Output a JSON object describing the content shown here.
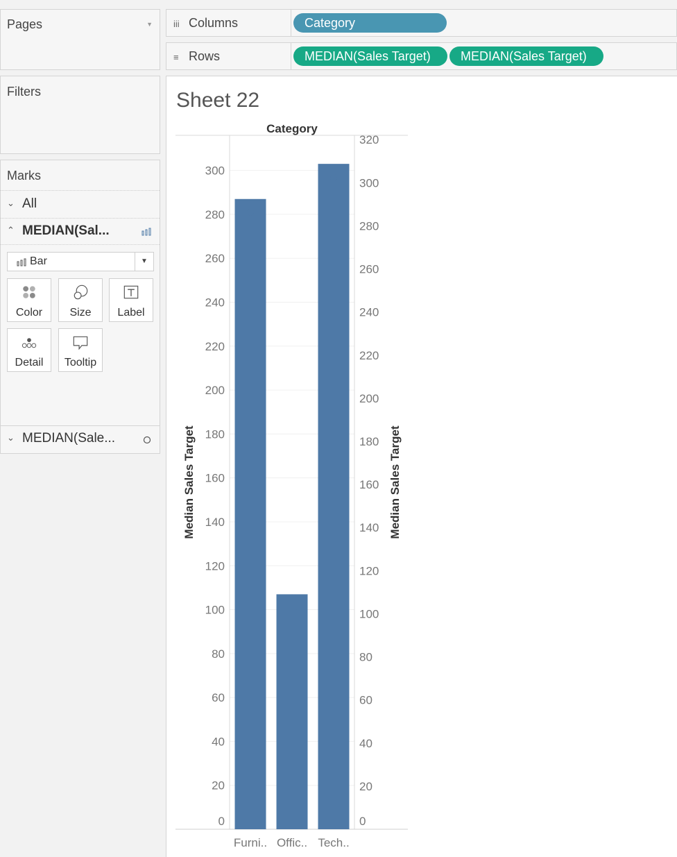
{
  "left_pane": {
    "pages": {
      "title": "Pages"
    },
    "filters": {
      "title": "Filters"
    },
    "marks": {
      "title": "Marks",
      "all_label": "All",
      "card1_label": "MEDIAN(Sal...",
      "mark_type": "Bar",
      "buttons": {
        "color": "Color",
        "size": "Size",
        "label": "Label",
        "detail": "Detail",
        "tooltip": "Tooltip"
      },
      "card2_label": "MEDIAN(Sale..."
    }
  },
  "shelves": {
    "columns": {
      "label": "Columns",
      "pills": [
        "Category"
      ]
    },
    "rows": {
      "label": "Rows",
      "pills": [
        "MEDIAN(Sales Target)",
        "MEDIAN(Sales Target)"
      ]
    }
  },
  "sheet": {
    "title": "Sheet 22"
  },
  "colors": {
    "bar": "#4e79a7",
    "dimension_pill": "#4996b2",
    "measure_pill": "#17a986"
  },
  "chart_data": {
    "type": "bar",
    "header": "Category",
    "categories": [
      "Furni..",
      "Offic..",
      "Tech.."
    ],
    "series": [
      {
        "values": [
          287,
          107,
          303
        ],
        "mark": "bar"
      },
      {
        "values": [
          287,
          107,
          303
        ],
        "mark": "circle"
      }
    ],
    "left_axis": {
      "label": "Median Sales Target",
      "range": [
        0,
        316
      ],
      "ticks": [
        "0",
        "20",
        "40",
        "60",
        "80",
        "100",
        "120",
        "140",
        "160",
        "180",
        "200",
        "220",
        "240",
        "260",
        "280",
        "300"
      ]
    },
    "right_axis": {
      "label": "Median Sales Target",
      "range": [
        0,
        322
      ],
      "ticks": [
        "0",
        "20",
        "40",
        "60",
        "80",
        "100",
        "120",
        "140",
        "160",
        "180",
        "200",
        "220",
        "240",
        "260",
        "280",
        "300",
        "320"
      ]
    },
    "grid": true
  }
}
